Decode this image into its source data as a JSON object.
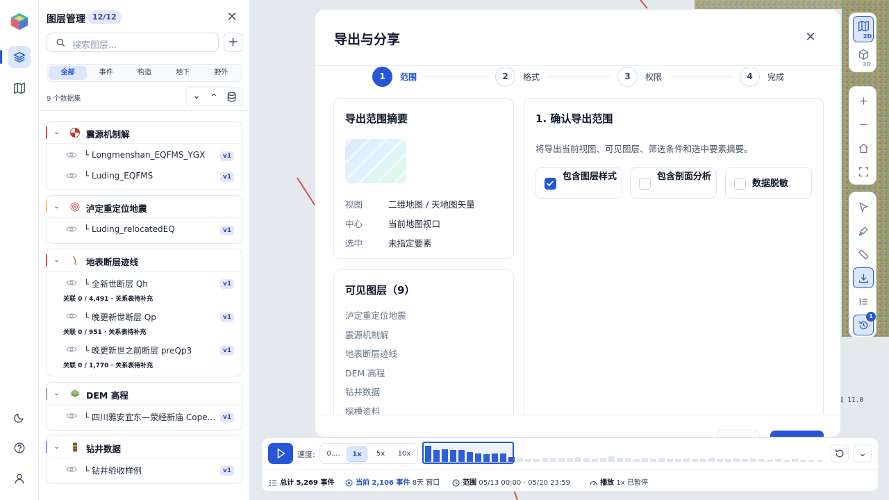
{
  "panel": {
    "title": "图层管理",
    "badge": "12/12",
    "search_placeholder": "搜索图层...",
    "tabs": [
      "全部",
      "事件",
      "构造",
      "地下",
      "野外"
    ],
    "active_tab": "全部",
    "dataset_count": "9 个数据集",
    "groups": [
      {
        "title": "震源机制解",
        "accent": "#e24a4a",
        "items": [
          {
            "name": "└ Longmenshan_EQFMS_YGX",
            "ver": "v1"
          },
          {
            "name": "└ Luding_EQFMS",
            "ver": "v1"
          }
        ]
      },
      {
        "title": "泸定重定位地震",
        "accent": "#f2c94c",
        "items": [
          {
            "name": "└ Luding_relocatedEQ",
            "ver": "v1"
          }
        ]
      },
      {
        "title": "地表断层迹线",
        "accent": "#e24a4a",
        "items": [
          {
            "name": "└ 全新世断层 Qh",
            "ver": "v1",
            "rel": "关联 0 / 4,491 · 关系表待补充"
          },
          {
            "name": "└ 晚更新世断层 Qp",
            "ver": "v1",
            "rel": "关联 0 / 951 · 关系表待补充"
          },
          {
            "name": "└ 晚更新世之前断层 preQp3",
            "ver": "v1",
            "rel": "关联 0 / 1,770 · 关系表待补充"
          }
        ]
      },
      {
        "title": "DEM 高程",
        "accent": "#a3a38a",
        "items": [
          {
            "name": "└ 四川雅安宜东—荥经新庙 Cope...",
            "ver": "v1"
          }
        ]
      },
      {
        "title": "钻井数据",
        "accent": "#9b8fd9",
        "items": [
          {
            "name": "└ 钻井验收样例",
            "ver": "v1"
          }
        ]
      }
    ]
  },
  "modal": {
    "title": "导出与分享",
    "steps": [
      {
        "num": "1",
        "label": "范围",
        "active": true
      },
      {
        "num": "2",
        "label": "格式",
        "active": false
      },
      {
        "num": "3",
        "label": "权限",
        "active": false
      },
      {
        "num": "4",
        "label": "完成",
        "active": false
      }
    ],
    "summary": {
      "title": "导出范围摘要",
      "rows": [
        {
          "k": "视图",
          "v": "二维地图 / 天地图矢量"
        },
        {
          "k": "中心",
          "v": "当前地图视口"
        },
        {
          "k": "选中",
          "v": "未指定要素"
        }
      ]
    },
    "visible_layers": {
      "title": "可见图层（9）",
      "items": [
        "泸定重定位地震",
        "震源机制解",
        "地表断层迹线",
        "DEM 高程",
        "钻井数据",
        "探槽资料"
      ]
    },
    "confirm": {
      "title": "1. 确认导出范围",
      "desc": "将导出当前视图、可见图层、筛选条件和选中要素摘要。",
      "options": [
        {
          "label": "包含图层样式",
          "checked": true
        },
        {
          "label": "包含剖面分析",
          "checked": false
        },
        {
          "label": "数据脱敏",
          "checked": false
        }
      ]
    }
  },
  "toolbar": {
    "view_2d": "2D",
    "view_3d": "3D",
    "history_badge": "1"
  },
  "map": {
    "scale_text": "敌 11.0"
  },
  "timeline": {
    "speed_label": "速度:",
    "speeds": [
      "0....",
      "1x",
      "5x",
      "10x"
    ],
    "active_speed": "1x",
    "total_label": "总计",
    "total_value": "5,269 事件",
    "current_label": "当前",
    "current_value": "2,106 事件",
    "window": "8天 窗口",
    "range_label": "范围",
    "range_value": "05/13 00:00 - 05/20 23:59",
    "play_label": "播放",
    "play_value": "1x 已暂停",
    "histogram": [
      0.95,
      0.72,
      0.75,
      0.72,
      0.72,
      0.6,
      0.5,
      0.45,
      0.5,
      0.5,
      0.3,
      0.22,
      0.15,
      0.15,
      0.2,
      0.2,
      0.22,
      0.2,
      0.28,
      0.2,
      0.15,
      0.2,
      0.35,
      0.25,
      0.2,
      0.15,
      0.2,
      0.15,
      0.2,
      0.15,
      0.15,
      0.2,
      0.15,
      0.15,
      0.2,
      0.15,
      0.15,
      0.2,
      0.15,
      0.2,
      0.15,
      0.12,
      0.15,
      0.12,
      0.15,
      0.12,
      0.12,
      0.12
    ],
    "selected_bars": 11
  }
}
